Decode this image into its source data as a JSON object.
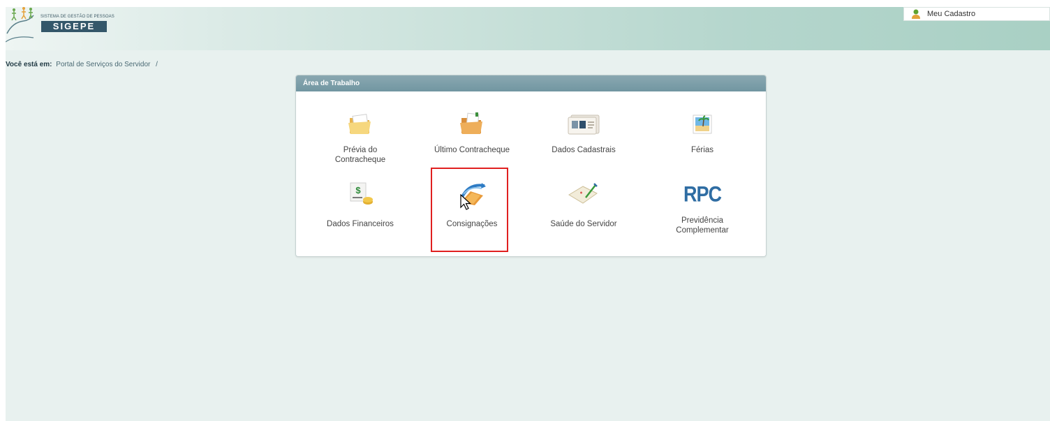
{
  "header": {
    "logo_subtitle": "SISTEMA DE GESTÃO DE PESSOAS",
    "logo_title": "SIGEPE",
    "user_menu_label": "Meu Cadastro"
  },
  "breadcrumb": {
    "label": "Você está em:",
    "current": "Portal de Serviços do Servidor",
    "separator": "/"
  },
  "panel": {
    "title": "Área de Trabalho",
    "tiles": [
      {
        "label": "Prévia do Contracheque",
        "icon": "folder-icon"
      },
      {
        "label": "Último Contracheque",
        "icon": "folder-document-icon"
      },
      {
        "label": "Dados Cadastrais",
        "icon": "id-card-icon"
      },
      {
        "label": "Férias",
        "icon": "beach-photo-icon"
      },
      {
        "label": "Dados Financeiros",
        "icon": "money-icon"
      },
      {
        "label": "Consignações",
        "icon": "consignment-arrow-icon"
      },
      {
        "label": "Saúde do Servidor",
        "icon": "health-document-icon"
      },
      {
        "label": "Previdência Complementar",
        "icon_text": "RPC",
        "icon": "rpc-icon"
      }
    ]
  },
  "colors": {
    "panel_header": "#7c9fa9",
    "highlight": "#e02020",
    "rpc_blue": "#2f6da3",
    "page_bg": "#e8f1ef"
  }
}
